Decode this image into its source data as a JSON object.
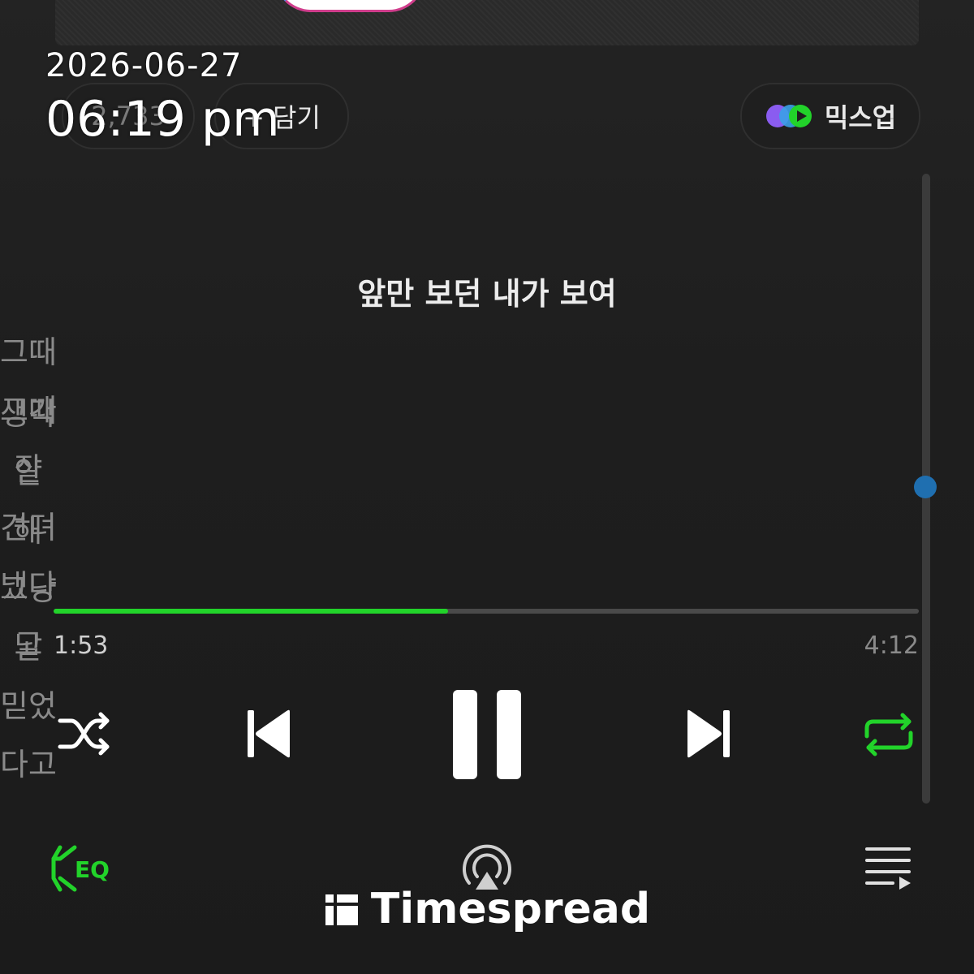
{
  "overlay": {
    "date": "2026-06-27",
    "time": "06:19 pm"
  },
  "actions": {
    "like_count": "2,733",
    "add_label": "+ 담기",
    "mixup_label": "믹스업"
  },
  "lyrics": {
    "current": "앞만 보던 내가 보여",
    "next1": "그때그때 잘 견뎌냈다고",
    "next2": "생각 안 해 그냥 날 믿었다고"
  },
  "playback": {
    "elapsed": "1:53",
    "total": "4:12",
    "progress_fraction": 0.456
  },
  "controls": {
    "shuffle_icon": "shuffle-icon",
    "prev_icon": "previous-icon",
    "pause_icon": "pause-icon",
    "next_icon": "next-icon",
    "repeat_icon": "repeat-icon",
    "eq_label": "EQ",
    "airplay_icon": "airplay-icon",
    "queue_icon": "queue-icon"
  },
  "watermark": {
    "text": "Timespread"
  },
  "colors": {
    "accent": "#22d32a",
    "scroll_thumb": "#1f6fb0"
  }
}
